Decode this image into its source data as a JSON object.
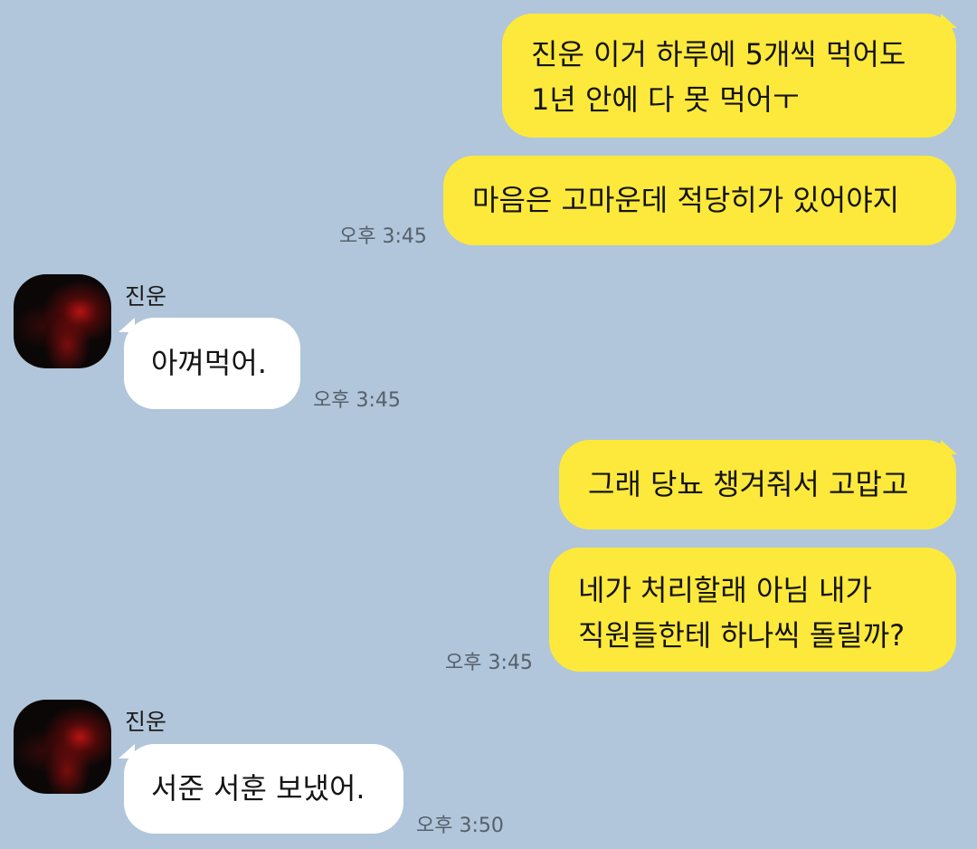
{
  "colors": {
    "background": "#b1c6da",
    "my_bubble": "#fde93b",
    "their_bubble": "#ffffff",
    "timestamp": "#55606c"
  },
  "messages": [
    {
      "from": "me",
      "text": "진운 이거 하루에 5개씩 먹어도\n1년 안에 다 못 먹어ㅜ"
    },
    {
      "from": "me",
      "text": "마음은 고마운데 적당히가 있어야지",
      "time": "오후 3:45"
    },
    {
      "from": "them",
      "sender": "진운",
      "avatar": "profile-photo",
      "text": "아껴먹어.",
      "time": "오후 3:45"
    },
    {
      "from": "me",
      "text": "그래 당뇨 챙겨줘서 고맙고"
    },
    {
      "from": "me",
      "text": "네가 처리할래 아님 내가\n직원들한테 하나씩 돌릴까?",
      "time": "오후 3:45"
    },
    {
      "from": "them",
      "sender": "진운",
      "avatar": "profile-photo",
      "text": "서준 서훈 보냈어.",
      "time": "오후 3:50"
    }
  ]
}
